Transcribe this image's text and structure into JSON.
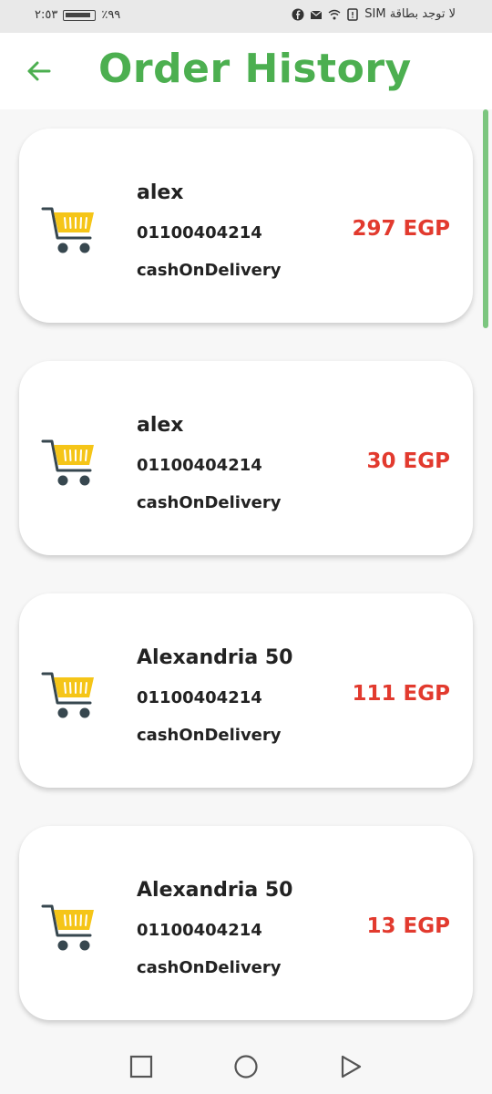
{
  "status_bar": {
    "time": "٢:٥٣",
    "battery": "٪٩٩",
    "carrier": "لا توجد بطاقة SIM"
  },
  "appbar": {
    "title": "Order History"
  },
  "orders": [
    {
      "name": "alex",
      "phone": "01100404214",
      "payment": "cashOnDelivery",
      "price": "297 EGP"
    },
    {
      "name": "alex",
      "phone": "01100404214",
      "payment": "cashOnDelivery",
      "price": "30 EGP"
    },
    {
      "name": "Alexandria 50",
      "phone": "01100404214",
      "payment": "cashOnDelivery",
      "price": "111 EGP"
    },
    {
      "name": "Alexandria 50",
      "phone": "01100404214",
      "payment": "cashOnDelivery",
      "price": "13 EGP"
    }
  ],
  "icons": {
    "back": "arrow-left-icon",
    "cart": "shopping-cart-icon",
    "nav": [
      "square-icon",
      "circle-icon",
      "triangle-back-icon"
    ]
  },
  "colors": {
    "accent": "#4caf50",
    "price": "#e23a2e",
    "cart_basket": "#f5c518",
    "cart_frame": "#37474f"
  }
}
